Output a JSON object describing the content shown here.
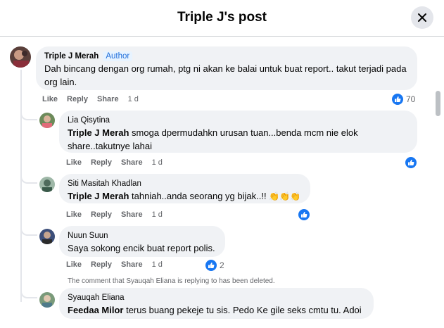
{
  "header": {
    "title": "Triple J's post"
  },
  "icons": {
    "close": "close-icon",
    "like": "thumbs-up-icon",
    "clap": "clapping-hands-emoji"
  },
  "colors": {
    "facebook_blue": "#1877f2",
    "bubble_bg": "#f0f2f5",
    "muted": "#65676b",
    "author_badge": "#216fdb"
  },
  "actions": {
    "like": "Like",
    "reply": "Reply",
    "share": "Share"
  },
  "comments": [
    {
      "author": "Triple J Merah",
      "badge": "Author",
      "text": "Dah bincang dengan org rumah, ptg ni akan ke balai untuk buat report.. takut terjadi pada org lain.",
      "time": "1 d",
      "reactions": "70"
    }
  ],
  "replies": [
    {
      "author": "Lia Qisytina",
      "mention": "Triple J Merah",
      "text": " smoga dpermudahkn urusan tuan...benda mcm nie elok share..takutnye lahai",
      "time": "1 d"
    },
    {
      "author": "Siti Masitah Khadlan",
      "mention": "Triple J Merah",
      "text": " tahniah..anda seorang yg bijak..!! ",
      "time": "1 d"
    },
    {
      "author": "Nuun Suun",
      "text": "Saya sokong encik buat report polis.",
      "time": "1 d",
      "reactions": "2"
    },
    {
      "deleted_note": "The comment that Syauqah Eliana is replying to has been deleted."
    },
    {
      "author": "Syauqah Eliana",
      "mention": "Feedaa Milor",
      "text": " terus buang pekeje tu sis. Pedo Ke gile seks cmtu tu. Adoi"
    }
  ]
}
